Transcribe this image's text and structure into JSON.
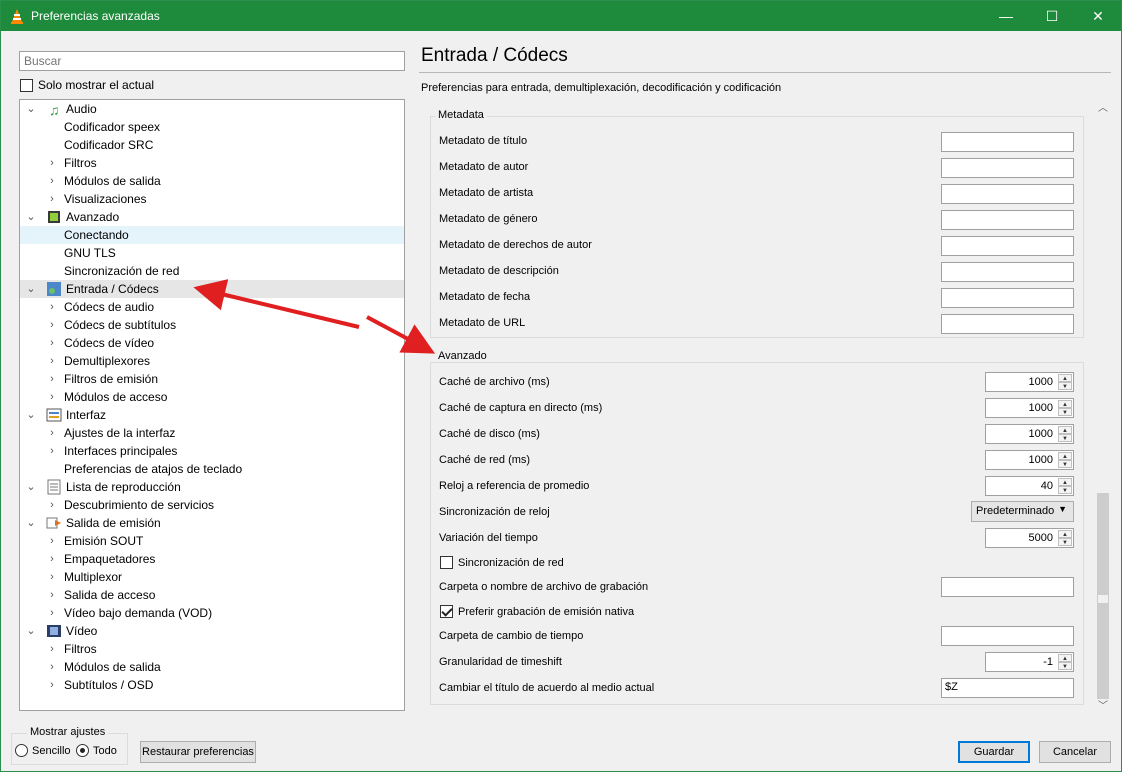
{
  "window": {
    "title": "Preferencias avanzadas",
    "buttons": {
      "minimize": "—",
      "maximize": "☐",
      "close": "✕"
    }
  },
  "left": {
    "search_placeholder": "Buscar",
    "only_current_label": "Solo mostrar el actual",
    "only_current_checked": false
  },
  "tree": [
    {
      "label": "Audio",
      "level": 0,
      "expanded": true,
      "icon": "audio-note-icon"
    },
    {
      "label": "Codificador speex",
      "level": 1,
      "hasChildren": false
    },
    {
      "label": "Codificador SRC",
      "level": 1,
      "hasChildren": false
    },
    {
      "label": "Filtros",
      "level": 1,
      "hasChildren": true
    },
    {
      "label": "Módulos de salida",
      "level": 1,
      "hasChildren": true
    },
    {
      "label": "Visualizaciones",
      "level": 1,
      "hasChildren": true
    },
    {
      "label": "Avanzado",
      "level": 0,
      "expanded": true,
      "icon": "chip-icon"
    },
    {
      "label": "Conectando",
      "level": 1,
      "hasChildren": false,
      "state": "hover"
    },
    {
      "label": "GNU TLS",
      "level": 1,
      "hasChildren": false
    },
    {
      "label": "Sincronización de red",
      "level": 1,
      "hasChildren": false
    },
    {
      "label": "Entrada / Códecs",
      "level": 0,
      "expanded": true,
      "icon": "input-codecs-icon",
      "state": "selected"
    },
    {
      "label": "Códecs de audio",
      "level": 1,
      "hasChildren": true
    },
    {
      "label": "Códecs de subtítulos",
      "level": 1,
      "hasChildren": true
    },
    {
      "label": "Códecs de vídeo",
      "level": 1,
      "hasChildren": true
    },
    {
      "label": "Demultiplexores",
      "level": 1,
      "hasChildren": true
    },
    {
      "label": "Filtros de emisión",
      "level": 1,
      "hasChildren": true
    },
    {
      "label": "Módulos de acceso",
      "level": 1,
      "hasChildren": true
    },
    {
      "label": "Interfaz",
      "level": 0,
      "expanded": true,
      "icon": "interface-icon"
    },
    {
      "label": "Ajustes de la interfaz",
      "level": 1,
      "hasChildren": true
    },
    {
      "label": "Interfaces principales",
      "level": 1,
      "hasChildren": true
    },
    {
      "label": "Preferencias de atajos de teclado",
      "level": 1,
      "hasChildren": false
    },
    {
      "label": "Lista de reproducción",
      "level": 0,
      "expanded": true,
      "icon": "playlist-icon"
    },
    {
      "label": "Descubrimiento de servicios",
      "level": 1,
      "hasChildren": true
    },
    {
      "label": "Salida de emisión",
      "level": 0,
      "expanded": true,
      "icon": "stream-output-icon"
    },
    {
      "label": "Emisión SOUT",
      "level": 1,
      "hasChildren": true
    },
    {
      "label": "Empaquetadores",
      "level": 1,
      "hasChildren": true
    },
    {
      "label": "Multiplexor",
      "level": 1,
      "hasChildren": true
    },
    {
      "label": "Salida de acceso",
      "level": 1,
      "hasChildren": true
    },
    {
      "label": "Vídeo bajo demanda (VOD)",
      "level": 1,
      "hasChildren": true
    },
    {
      "label": "Vídeo",
      "level": 0,
      "expanded": true,
      "icon": "video-film-icon"
    },
    {
      "label": "Filtros",
      "level": 1,
      "hasChildren": true
    },
    {
      "label": "Módulos de salida",
      "level": 1,
      "hasChildren": true
    },
    {
      "label": "Subtítulos / OSD",
      "level": 1,
      "hasChildren": true
    }
  ],
  "right": {
    "title": "Entrada / Códecs",
    "subtitle": "Preferencias para entrada, demultiplexación, decodificación y codificación",
    "metadata": {
      "title": "Metadata",
      "fields": [
        {
          "label": "Metadato de título",
          "value": ""
        },
        {
          "label": "Metadato de autor",
          "value": ""
        },
        {
          "label": "Metadato de artista",
          "value": ""
        },
        {
          "label": "Metadato de género",
          "value": ""
        },
        {
          "label": "Metadato de derechos de autor",
          "value": ""
        },
        {
          "label": "Metadato de descripción",
          "value": ""
        },
        {
          "label": "Metadato de fecha",
          "value": ""
        },
        {
          "label": "Metadato de URL",
          "value": ""
        }
      ]
    },
    "advanced": {
      "title": "Avanzado",
      "file_cache": {
        "label": "Caché de archivo (ms)",
        "value": "1000"
      },
      "live_cache": {
        "label": "Caché de captura en directo (ms)",
        "value": "1000"
      },
      "disc_cache": {
        "label": "Caché de disco (ms)",
        "value": "1000"
      },
      "network_cache": {
        "label": "Caché de red (ms)",
        "value": "1000"
      },
      "clock_ref": {
        "label": "Reloj a referencia de promedio",
        "value": "40"
      },
      "clock_sync": {
        "label": "Sincronización de reloj",
        "value": "Predeterminado"
      },
      "clock_jitter": {
        "label": "Variación del tiempo",
        "value": "5000"
      },
      "netsync": {
        "label": "Sincronización de red",
        "checked": false
      },
      "record_path": {
        "label": "Carpeta o nombre de archivo de grabación",
        "value": ""
      },
      "native_record": {
        "label": "Preferir grabación de emisión nativa",
        "checked": true
      },
      "timeshift_path": {
        "label": "Carpeta de cambio de tiempo",
        "value": ""
      },
      "timeshift_gran": {
        "label": "Granularidad de timeshift",
        "value": "-1"
      },
      "title_change": {
        "label": "Cambiar el título de acuerdo al medio actual",
        "value": "$Z"
      }
    }
  },
  "bottom": {
    "show_settings_title": "Mostrar ajustes",
    "simple_label": "Sencillo",
    "all_label": "Todo",
    "selected_mode": "all",
    "reset_label": "Restaurar preferencias",
    "save_label": "Guardar",
    "cancel_label": "Cancelar"
  },
  "colors": {
    "titlebar": "#1e8a3c",
    "annotation_arrow": "#e02020",
    "accent": "#0078d7"
  }
}
